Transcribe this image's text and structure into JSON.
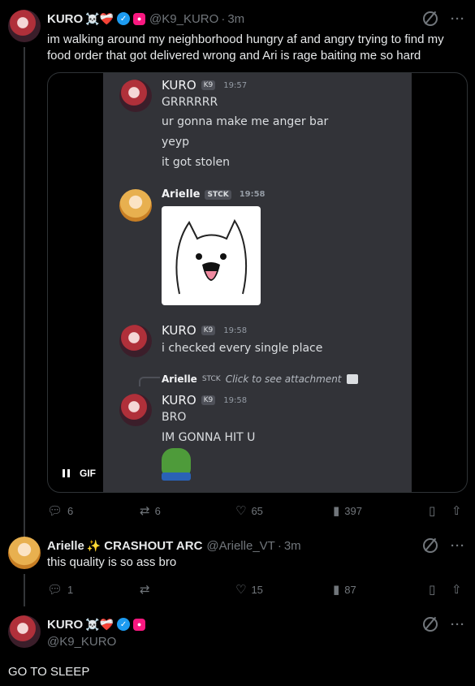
{
  "tweet1": {
    "name": "KURO",
    "emoji": "☠️❤️‍🩹",
    "handle": "@K9_KURO",
    "time": "3m",
    "text": "im walking around my neighborhood hungry af and angry trying to find my food order that got delivered wrong and Ari is rage baiting me so hard",
    "media": {
      "gif_label": "GIF",
      "messages": {
        "m1_name": "KURO",
        "m1_tag": "K9",
        "m1_time": "19:57",
        "m1_lines": [
          "GRRRRRR",
          "ur gonna make me anger bar",
          "yeyp",
          "it got stolen"
        ],
        "m2_name": "Arielle",
        "m2_tag": "STCK",
        "m2_time": "19:58",
        "m3_name": "KURO",
        "m3_tag": "K9",
        "m3_time": "19:58",
        "m3_line": "i checked every single place",
        "reply_name": "Arielle",
        "reply_tag": "STCK",
        "reply_text": "Click to see attachment",
        "m4_name": "KURO",
        "m4_tag": "K9",
        "m4_time": "19:58",
        "m4_lines": [
          "BRO",
          "IM GONNA HIT U"
        ]
      }
    },
    "stats": {
      "replies": "6",
      "retweets": "6",
      "likes": "65",
      "views": "397"
    }
  },
  "tweet2": {
    "name": "Arielle",
    "emoji": "✨",
    "name_suffix": "CRASHOUT ARC",
    "handle": "@Arielle_VT",
    "time": "3m",
    "text": "this quality is so ass bro",
    "stats": {
      "replies": "1",
      "retweets": "",
      "likes": "15",
      "views": "87"
    }
  },
  "tweet3": {
    "name": "KURO",
    "emoji": "☠️❤️‍🩹",
    "handle": "@K9_KURO",
    "text": "GO TO SLEEP"
  },
  "colors": {
    "background": "#000000",
    "text": "#e7e9ea",
    "muted": "#71767b",
    "verified": "#1d9bf0",
    "discord_bg": "#323338"
  }
}
